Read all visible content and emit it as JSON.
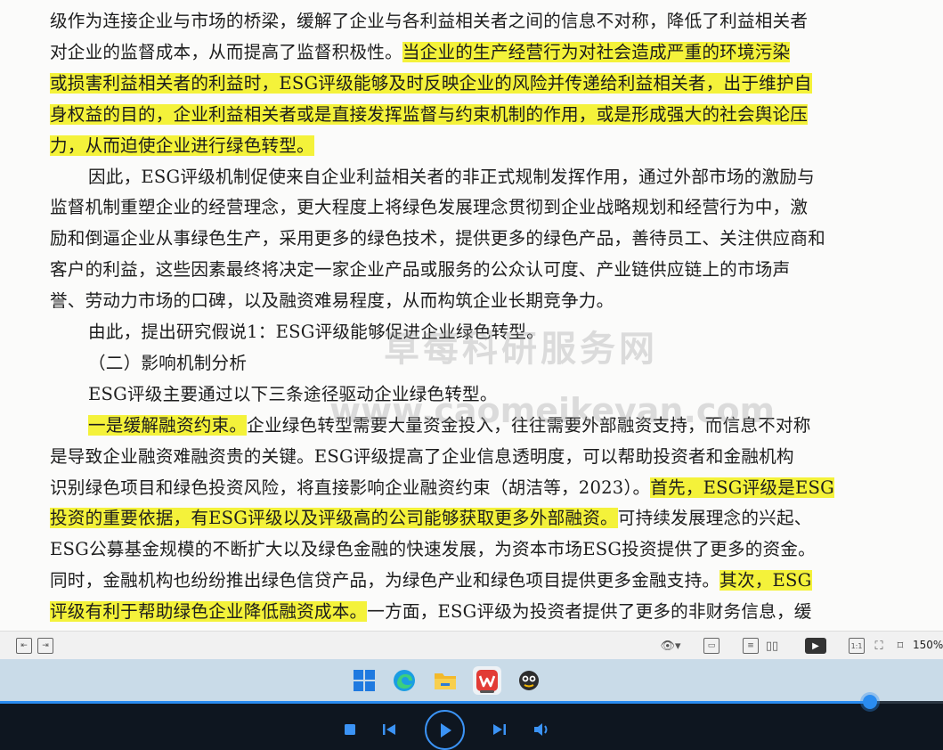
{
  "document": {
    "lines": [
      {
        "segments": [
          {
            "text": "级作为连接企业与市场的桥梁，缓解了企业与各利益相关者之间的信息不对称，降低了利益相关者",
            "hl": false
          }
        ]
      },
      {
        "segments": [
          {
            "text": "对企业的监督成本，从而提高了监督积极性。",
            "hl": false
          },
          {
            "text": "当企业的生产经营行为对社会造成严重的环境污染",
            "hl": true
          }
        ]
      },
      {
        "segments": [
          {
            "text": "或损害利益相关者的利益时，ESG评级能够及时反映企业的风险并传递给利益相关者，出于维护自",
            "hl": true
          }
        ]
      },
      {
        "segments": [
          {
            "text": "身权益的目的，企业利益相关者或是直接发挥监督与约束机制的作用，或是形成强大的社会舆论压",
            "hl": true
          }
        ]
      },
      {
        "segments": [
          {
            "text": "力，从而迫使企业进行绿色转型。",
            "hl": true
          }
        ]
      },
      {
        "indent": true,
        "segments": [
          {
            "text": "因此，ESG评级机制促使来自企业利益相关者的非正式规制发挥作用，通过外部市场的激励与",
            "hl": false
          }
        ]
      },
      {
        "segments": [
          {
            "text": "监督机制重塑企业的经营理念，更大程度上将绿色发展理念贯彻到企业战略规划和经营行为中，激",
            "hl": false
          }
        ]
      },
      {
        "segments": [
          {
            "text": "励和倒逼企业从事绿色生产，采用更多的绿色技术，提供更多的绿色产品，善待员工、关注供应商和",
            "hl": false
          }
        ]
      },
      {
        "segments": [
          {
            "text": "客户的利益，这些因素最终将决定一家企业产品或服务的公众认可度、产业链供应链上的市场声",
            "hl": false
          }
        ]
      },
      {
        "segments": [
          {
            "text": "誉、劳动力市场的口碑，以及融资难易程度，从而构筑企业长期竞争力。",
            "hl": false
          }
        ]
      },
      {
        "indent": true,
        "segments": [
          {
            "text": "由此，提出研究假说1：ESG评级能够促进企业绿色转型。",
            "hl": false
          }
        ]
      },
      {
        "indent": true,
        "segments": [
          {
            "text": "（二）影响机制分析",
            "hl": false
          }
        ]
      },
      {
        "indent": true,
        "segments": [
          {
            "text": "ESG评级主要通过以下三条途径驱动企业绿色转型。",
            "hl": false
          }
        ]
      },
      {
        "indent": true,
        "segments": [
          {
            "text": "一是缓解融资约束。",
            "hl": true
          },
          {
            "text": "企业绿色转型需要大量资金投入，往往需要外部融资支持，而信息不对称",
            "hl": false
          }
        ]
      },
      {
        "segments": [
          {
            "text": "是导致企业融资难融资贵的关键。ESG评级提高了企业信息透明度，可以帮助投资者和金融机构",
            "hl": false
          }
        ]
      },
      {
        "segments": [
          {
            "text": "识别绿色项目和绿色投资风险，将直接影响企业融资约束（胡洁等，2023）。",
            "hl": false
          },
          {
            "text": "首先，ESG评级是ESG",
            "hl": true
          }
        ]
      },
      {
        "segments": [
          {
            "text": "投资的重要依据，有ESG评级以及评级高的公司能够获取更多外部融资。",
            "hl": true
          },
          {
            "text": "可持续发展理念的兴起、",
            "hl": false
          }
        ]
      },
      {
        "segments": [
          {
            "text": "ESG公募基金规模的不断扩大以及绿色金融的快速发展，为资本市场ESG投资提供了更多的资金。",
            "hl": false
          }
        ]
      },
      {
        "segments": [
          {
            "text": "同时，金融机构也纷纷推出绿色信贷产品，为绿色产业和绿色项目提供更多金融支持。",
            "hl": false
          },
          {
            "text": "其次，ESG",
            "hl": true
          }
        ]
      },
      {
        "segments": [
          {
            "text": "评级有利于帮助绿色企业降低融资成本。",
            "hl": true
          },
          {
            "text": "一方面，ESG评级为投资者提供了更多的非财务信息，缓",
            "hl": false
          }
        ]
      }
    ],
    "watermark": {
      "line1": "草莓科研服务网",
      "line2": "www.caomeikeyan.com"
    }
  },
  "statusbar": {
    "zoom": "150%",
    "icons": [
      "collapse-left-icon",
      "expand-right-icon",
      "eye-protection-icon",
      "single-page-icon",
      "scroll-page-icon",
      "double-page-icon",
      "play-slideshow-icon",
      "fit-page-icon",
      "fullscreen-icon",
      "fit-width-icon"
    ]
  },
  "taskbar": {
    "apps": [
      "windows-start-icon",
      "edge-browser-icon",
      "file-explorer-icon",
      "wps-office-icon",
      "chat-app-icon"
    ]
  },
  "player": {
    "progress": 0.923,
    "controls": [
      "stop-icon",
      "previous-icon",
      "play-icon",
      "next-icon",
      "volume-icon"
    ],
    "accent": "#3b93f5"
  },
  "colors": {
    "highlight": "#f4f23a",
    "text": "#1d1d1d",
    "taskbar": "#c9dbe8",
    "player_bg": "#0e1620"
  }
}
